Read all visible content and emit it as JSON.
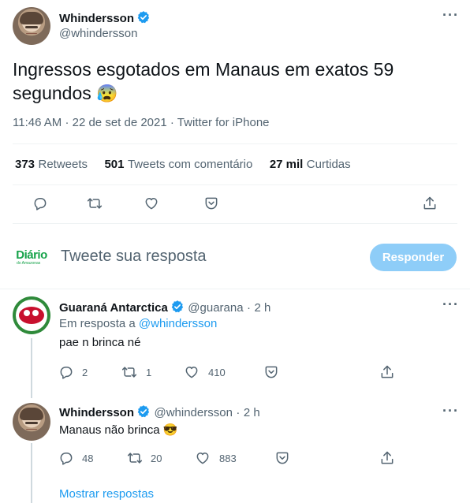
{
  "main_tweet": {
    "author_name": "Whindersson",
    "author_handle": "@whindersson",
    "text": "Ingressos esgotados em Manaus em exatos 59",
    "text_line2": "segundos",
    "emoji": "😰",
    "time": "11:46 AM",
    "date": "22 de set de 2021",
    "source": "Twitter for iPhone",
    "sep": "·",
    "stats": {
      "retweets_num": "373",
      "retweets_label": "Retweets",
      "quotes_num": "501",
      "quotes_label": "Tweets com comentário",
      "likes_num": "27 mil",
      "likes_label": "Curtidas"
    }
  },
  "compose": {
    "avatar_text": "Diário",
    "avatar_subtext": "do Amazonas",
    "placeholder": "Tweete sua resposta",
    "button_label": "Responder"
  },
  "replies": [
    {
      "author_name": "Guaraná Antarctica",
      "author_handle": "@guarana",
      "time": "2 h",
      "replying_to_prefix": "Em resposta a",
      "replying_to_handle": "@whindersson",
      "text": "pae n brinca né",
      "replies": "2",
      "retweets": "1",
      "likes": "410"
    },
    {
      "author_name": "Whindersson",
      "author_handle": "@whindersson",
      "time": "2 h",
      "text": "Manaus não brinca",
      "emoji": "😎",
      "replies": "48",
      "retweets": "20",
      "likes": "883"
    }
  ],
  "show_replies_label": "Mostrar respostas",
  "colors": {
    "accent": "#1d9bf0",
    "verified": "#1d9bf0",
    "reply_button": "#8ecdf8",
    "muted": "#536471"
  },
  "icons": [
    "reply-icon",
    "retweet-icon",
    "like-icon",
    "share-icon",
    "upload-icon",
    "more-icon",
    "verified-icon"
  ]
}
